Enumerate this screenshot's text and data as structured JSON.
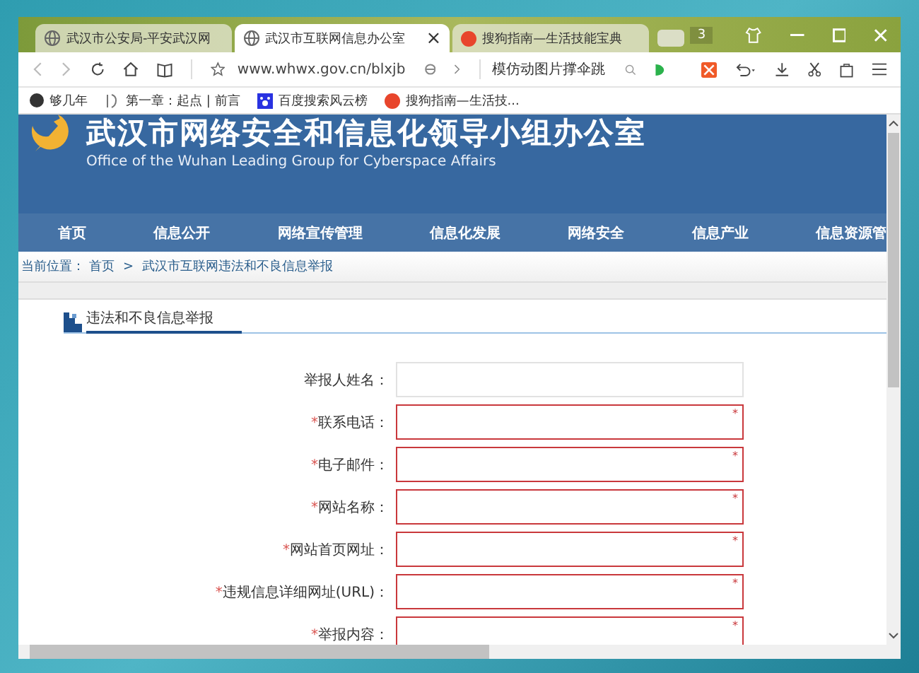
{
  "browser": {
    "tabs": [
      {
        "title": "武汉市公安局-平安武汉网",
        "selected": false
      },
      {
        "title": "武汉市互联网信息办公室",
        "selected": true
      },
      {
        "title": "搜狗指南—生活技能宝典",
        "selected": false
      }
    ],
    "tab_count": "3",
    "close_glyph": "×",
    "url": "www.whwx.gov.cn/blxjb",
    "search_text": "模仿动图片撑伞跳",
    "bookmarks": [
      "够几年",
      "第一章：起点 | 前言",
      "百度搜索风云榜",
      "搜狗指南—生活技..."
    ]
  },
  "page": {
    "title": "武汉市网络安全和信息化领导小组办公室",
    "subtitle": "Office of the Wuhan Leading Group for Cyberspace Affairs",
    "nav": [
      "首页",
      "信息公开",
      "网络宣传管理",
      "信息化发展",
      "网络安全",
      "信息产业",
      "信息资源管"
    ],
    "breadcrumb": {
      "prefix": "当前位置：",
      "home": "首页",
      "separator": ">",
      "current": "武汉市互联网违法和不良信息举报"
    },
    "section_title": "违法和不良信息举报",
    "fields": [
      {
        "label": "举报人姓名：",
        "required": false
      },
      {
        "mark": "*",
        "label": "联系电话：",
        "required": true,
        "corner": "*"
      },
      {
        "mark": "*",
        "label": "电子邮件：",
        "required": true,
        "corner": "*"
      },
      {
        "mark": "*",
        "label": "网站名称：",
        "required": true,
        "corner": "*"
      },
      {
        "mark": "*",
        "label": "网站首页网址：",
        "required": true,
        "corner": "*"
      },
      {
        "mark": "*",
        "label": "违规信息详细网址(URL)：",
        "required": true,
        "corner": "*"
      },
      {
        "mark": "*",
        "label": "举报内容：",
        "required": true,
        "corner": "*"
      }
    ]
  }
}
